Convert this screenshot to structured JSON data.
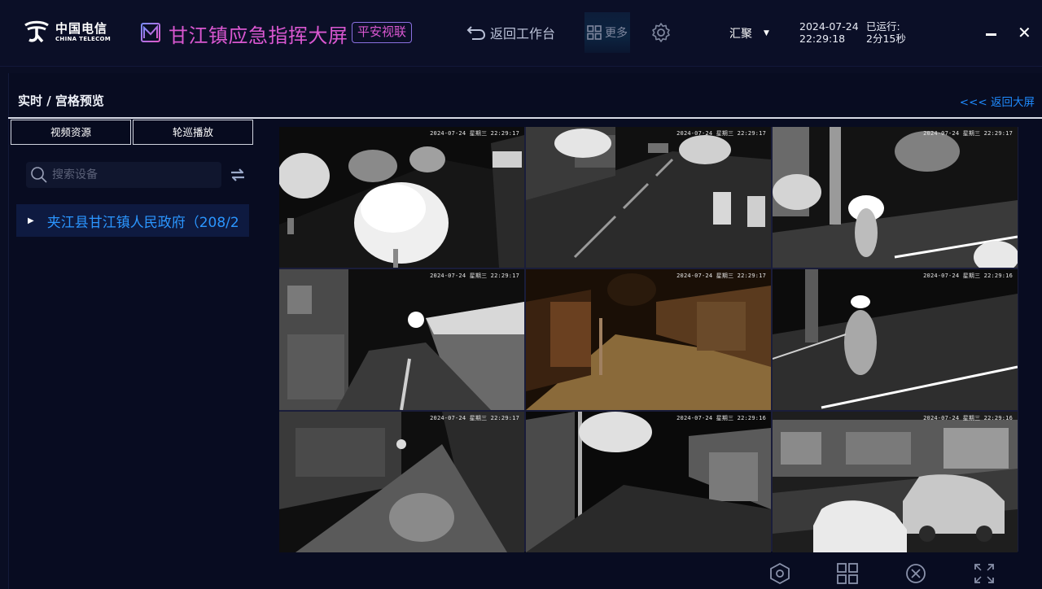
{
  "brand": {
    "logo_cn": "中国电信",
    "logo_en": "CHINA TELECOM"
  },
  "header": {
    "app_title": "甘江镇应急指挥大屏",
    "app_badge": "平安视联",
    "back_label": "返回工作台",
    "more_label": "更多",
    "aggregate_label": "汇聚",
    "date": "2024-07-24",
    "time": "22:29:18",
    "uptime_label": "已运行:",
    "uptime_value": "2分15秒"
  },
  "breadcrumb": "实时 / 宫格预览",
  "back_big_screen": "<<< 返回大屏",
  "sidebar": {
    "tabs": [
      "视频资源",
      "轮巡播放"
    ],
    "search_placeholder": "搜索设备",
    "tree": [
      {
        "label": "夹江县甘江镇人民政府（208/2"
      }
    ]
  },
  "grid": {
    "layout": "3x3",
    "cells": [
      {
        "timestamp": "2024-07-24 星期三 22:29:17",
        "scene": "trees-road-night"
      },
      {
        "timestamp": "2024-07-24 星期三 22:29:17",
        "scene": "street-bins-night"
      },
      {
        "timestamp": "2024-07-24 星期三 22:29:17",
        "scene": "road-car-headlights"
      },
      {
        "timestamp": "2024-07-24 星期三 22:29:17",
        "scene": "alley-wet-street"
      },
      {
        "timestamp": "2024-07-24 星期三 22:29:17",
        "scene": "shops-street-color"
      },
      {
        "timestamp": "2024-07-24 星期三 22:29:16",
        "scene": "road-car-rain"
      },
      {
        "timestamp": "2024-07-24 星期三 22:29:17",
        "scene": "wet-street-shops"
      },
      {
        "timestamp": "2024-07-24 星期三 22:29:16",
        "scene": "lane-tree-shutters"
      },
      {
        "timestamp": "2024-07-24 星期三 22:29:16",
        "scene": "parked-cars-shopfront"
      }
    ]
  },
  "toolbar": {
    "icons": [
      "hexagon-settings-icon",
      "grid-layout-icon",
      "close-circle-icon",
      "fullscreen-icon"
    ]
  },
  "colors": {
    "background": "#0a0e24",
    "title": "#d957d0",
    "accent_blue": "#2b96ff",
    "link_blue": "#1f8bff"
  }
}
